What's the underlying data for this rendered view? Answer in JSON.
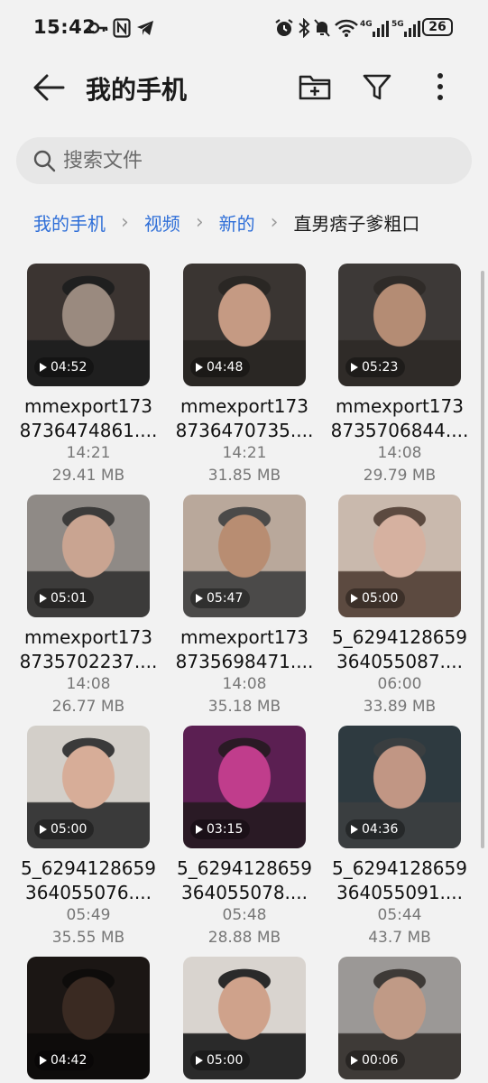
{
  "status_bar": {
    "time": "15:42",
    "battery": "26",
    "icons": [
      "key-icon",
      "nfc-icon",
      "telegram-icon",
      "alarm-icon",
      "bluetooth-icon",
      "mute-icon",
      "wifi-icon",
      "signal-4g-icon",
      "signal-5g-icon"
    ]
  },
  "header": {
    "title": "我的手机"
  },
  "search": {
    "placeholder": "搜索文件"
  },
  "breadcrumb": [
    "我的手机",
    "视频",
    "新的",
    "直男痞子爹粗口"
  ],
  "files": [
    {
      "name": "mmexport173\n8736474861....",
      "time": "14:21",
      "size": "29.41 MB",
      "duration": "04:52",
      "colors": [
        "#3b3431",
        "#9a8a7f",
        "#1f1f1f"
      ]
    },
    {
      "name": "mmexport173\n8736470735....",
      "time": "14:21",
      "size": "31.85 MB",
      "duration": "04:48",
      "colors": [
        "#3a3532",
        "#c59a83",
        "#2a2724"
      ]
    },
    {
      "name": "mmexport173\n8735706844....",
      "time": "14:08",
      "size": "29.79 MB",
      "duration": "05:23",
      "colors": [
        "#3d3937",
        "#b48c74",
        "#2f2b28"
      ]
    },
    {
      "name": "mmexport173\n8735702237....",
      "time": "14:08",
      "size": "26.77 MB",
      "duration": "05:01",
      "colors": [
        "#8f8a86",
        "#c9a491",
        "#3c3b3a"
      ]
    },
    {
      "name": "mmexport173\n8735698471....",
      "time": "14:08",
      "size": "35.18 MB",
      "duration": "05:47",
      "colors": [
        "#b9a89b",
        "#b88d72",
        "#4b4a49"
      ]
    },
    {
      "name": "5_6294128659\n364055087....",
      "time": "06:00",
      "size": "33.89 MB",
      "duration": "05:00",
      "colors": [
        "#c9b9ad",
        "#d6b1a0",
        "#5c4a40"
      ]
    },
    {
      "name": "5_6294128659\n364055076....",
      "time": "05:49",
      "size": "35.55 MB",
      "duration": "05:00",
      "colors": [
        "#d3cfc9",
        "#d7ad98",
        "#3a3a3a"
      ]
    },
    {
      "name": "5_6294128659\n364055078....",
      "time": "05:48",
      "size": "28.88 MB",
      "duration": "03:15",
      "colors": [
        "#5b1f52",
        "#c03d8c",
        "#2a1a25"
      ]
    },
    {
      "name": "5_6294128659\n364055091....",
      "time": "05:44",
      "size": "43.7 MB",
      "duration": "04:36",
      "colors": [
        "#2e3a40",
        "#c19684",
        "#3a3e40"
      ]
    },
    {
      "name": "",
      "time": "",
      "size": "",
      "duration": "04:42",
      "colors": [
        "#1b1614",
        "#3a2a22",
        "#0e0c0b"
      ]
    },
    {
      "name": "",
      "time": "",
      "size": "",
      "duration": "05:00",
      "colors": [
        "#d9d4cf",
        "#cfa28b",
        "#2a2a2a"
      ]
    },
    {
      "name": "",
      "time": "",
      "size": "",
      "duration": "00:06",
      "colors": [
        "#9b9896",
        "#c09a86",
        "#3e3a37"
      ]
    }
  ]
}
